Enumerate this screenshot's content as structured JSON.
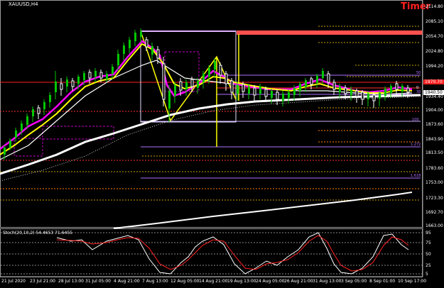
{
  "window": {
    "symbol_label": "XAUUSD,H4",
    "timer_label": "Timer"
  },
  "price_axis": {
    "ticks": [
      "2114.80",
      "2085.10",
      "2054.70",
      "2024.80",
      "1994.20",
      "1964.30",
      "1934.40",
      "1904.00",
      "1873.60",
      "1843.90",
      "1813.50",
      "1783.60",
      "1753.00",
      "1723.30",
      "1692.70",
      "1663.00"
    ],
    "current_price_label": "1940.50",
    "red_tag_label": "1970.70",
    "small_labels": [
      "50",
      "0",
      "38",
      "100",
      "1.272",
      "1.618"
    ]
  },
  "time_axis": {
    "ticks": [
      "21 Jul 2020",
      "23 Jul 21:00",
      "28 Jul 13:00",
      "31 Jul 05:00",
      "4 Aug 21:00",
      "7 Aug 13:00",
      "12 Aug 05:00",
      "14 Aug 21:00",
      "19 Aug 13:00",
      "24 Aug 05:00",
      "26 Aug 21:00",
      "31 Aug 13:00",
      "3 Sep 05:00",
      "8 Sep 01:00",
      "10 Sep 17:00"
    ]
  },
  "stochastic": {
    "label": "Stoch(20,10,2) 54.4653 71.6455",
    "levels": [
      "95",
      "75",
      "50",
      "25",
      "5"
    ]
  },
  "colors": {
    "background": "#000000",
    "bull_candle": "#00c800",
    "bear_candle": "#ffffff",
    "ema_white": "#ffffff",
    "ema_magenta": "#ff00ff",
    "ema_yellow": "#ffff00",
    "fib_lines": "#9a4dff",
    "resistance_red": "#ff4040",
    "stoch_main": "#ffffff",
    "stoch_signal": "#ff2020"
  }
}
